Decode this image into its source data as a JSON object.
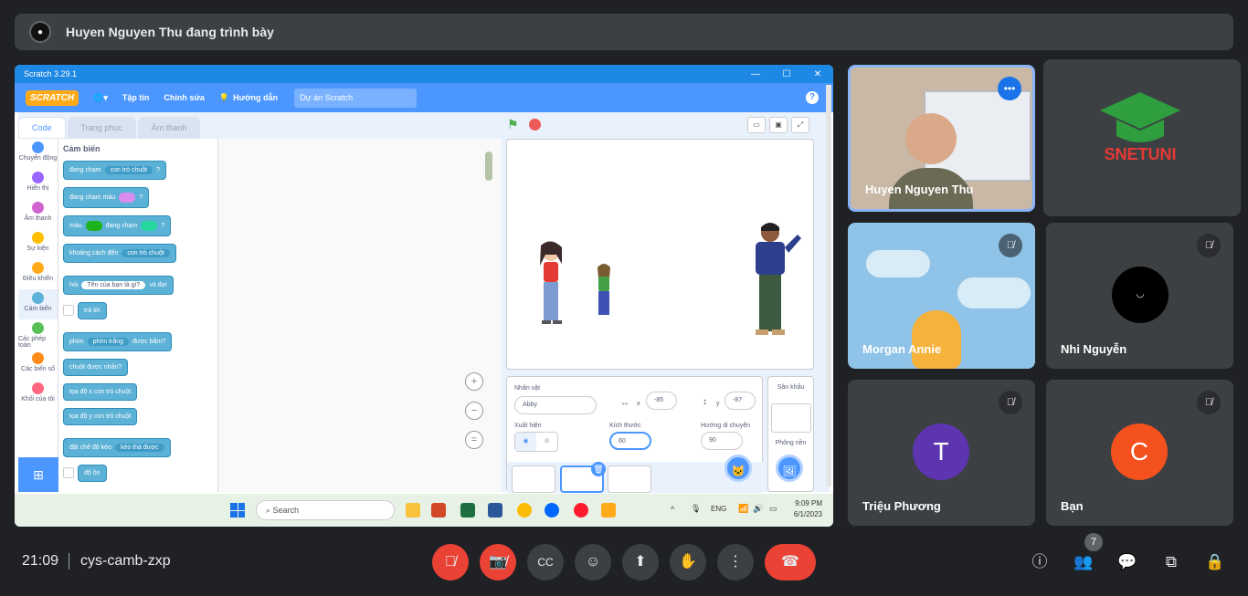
{
  "presenter_bar": {
    "text": "Huyen Nguyen Thu đang trình bày"
  },
  "scratch": {
    "window_title": "Scratch 3.29.1",
    "logo": "SCRATCH",
    "menu": {
      "file": "Tập tin",
      "edit": "Chỉnh sửa",
      "tutorials": "Hướng dẫn",
      "project_name": "Dự án Scratch"
    },
    "tabs": {
      "code": "Code",
      "costumes": "Trang phục",
      "sounds": "Âm thanh"
    },
    "categories": [
      {
        "label": "Chuyển động",
        "color": "#4c97ff"
      },
      {
        "label": "Hiển thị",
        "color": "#9966ff"
      },
      {
        "label": "Âm thanh",
        "color": "#cf63cf"
      },
      {
        "label": "Sự kiện",
        "color": "#ffbf00"
      },
      {
        "label": "Điều khiển",
        "color": "#ffab19"
      },
      {
        "label": "Cảm biến",
        "color": "#5cb1d6"
      },
      {
        "label": "Các phép toán",
        "color": "#59c059"
      },
      {
        "label": "Các biến số",
        "color": "#ff8c1a"
      },
      {
        "label": "Khối của tôi",
        "color": "#ff6680"
      }
    ],
    "palette": {
      "heading": "Cảm biến",
      "b1_a": "đang chạm",
      "b1_dd": "con trỏ chuột",
      "b1_q": "?",
      "b2_a": "đang chạm màu",
      "b2_q": "?",
      "b3_a": "màu",
      "b3_b": "đang chạm",
      "b3_q": "?",
      "b4_a": "khoảng cách đến",
      "b4_dd": "con trỏ chuột",
      "b5_a": "hỏi",
      "b5_in": "Tên của bạn là gì?",
      "b5_b": "và đợi",
      "b6": "trả lời",
      "b7_a": "phím",
      "b7_dd": "phím trắng",
      "b7_b": "được bấm?",
      "b8": "chuột được nhấn?",
      "b9": "tọa độ x con trỏ chuột",
      "b10": "tọa độ y con trỏ chuột",
      "b11_a": "đặt chế độ kéo",
      "b11_dd": "kéo thả được",
      "b12": "độ ồn"
    },
    "sprite_info": {
      "sprite_label": "Nhân vật",
      "sprite_name": "Abby",
      "x_label": "x",
      "x": "-85",
      "y_label": "y",
      "y": "-87",
      "show_label": "Xuất hiện",
      "size_label": "Kích thước",
      "size": "60",
      "direction_label": "Hướng di chuyển",
      "direction": "90"
    },
    "stage_pane": {
      "title": "Sân khấu",
      "backdrops": "Phông nền"
    }
  },
  "taskbar": {
    "search": "Search",
    "lang": "ENG",
    "clock": "9:09 PM",
    "date": "6/1/2023"
  },
  "participants": [
    {
      "name": "Huyen Nguyen Thu"
    },
    {
      "name": "Morgan Annie"
    },
    {
      "name": "Nhi Nguyễn"
    },
    {
      "name": "Triệu Phương",
      "initial": "T",
      "color": "#5e35b1"
    },
    {
      "name": "Bạn",
      "initial": "C",
      "color": "#f4511e"
    }
  ],
  "brand_tile": {
    "logo_text": "SNETUNI",
    "logo_color": "#2e9e3e",
    "text_color": "#e53935"
  },
  "bottom": {
    "time": "21:09",
    "meeting_code": "cys-camb-zxp",
    "people_count": "7"
  }
}
